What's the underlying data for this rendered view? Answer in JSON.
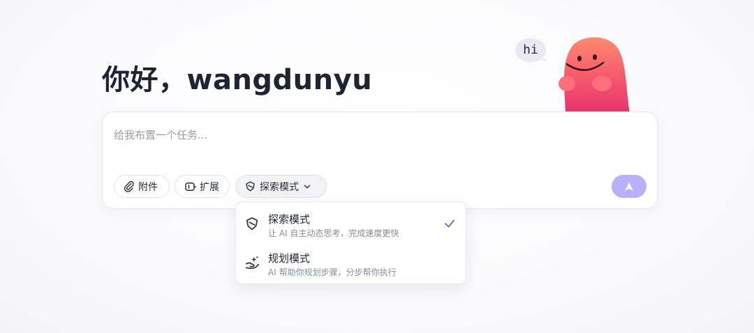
{
  "greeting": "你好，wangdunyu",
  "mascot": {
    "speech": "hi"
  },
  "task": {
    "placeholder": "给我布置一个任务...",
    "value": ""
  },
  "toolbar": {
    "attach_label": "附件",
    "extend_label": "扩展",
    "mode_label": "探索模式"
  },
  "send": {
    "color": "#b9b0fb"
  },
  "mode_menu": {
    "selected": "探索模式",
    "options": [
      {
        "title": "探索模式",
        "desc": "让 AI 自主动态思考，完成速度更快",
        "icon": "shield-icon",
        "selected": true
      },
      {
        "title": "规划模式",
        "desc": "AI 帮助你规划步骤，分步帮你执行",
        "icon": "plan-hand-icon",
        "selected": false
      }
    ]
  },
  "colors": {
    "accent": "#6b5cf0",
    "send_button": "#b9b0fb",
    "mascot": "#f5576c"
  }
}
